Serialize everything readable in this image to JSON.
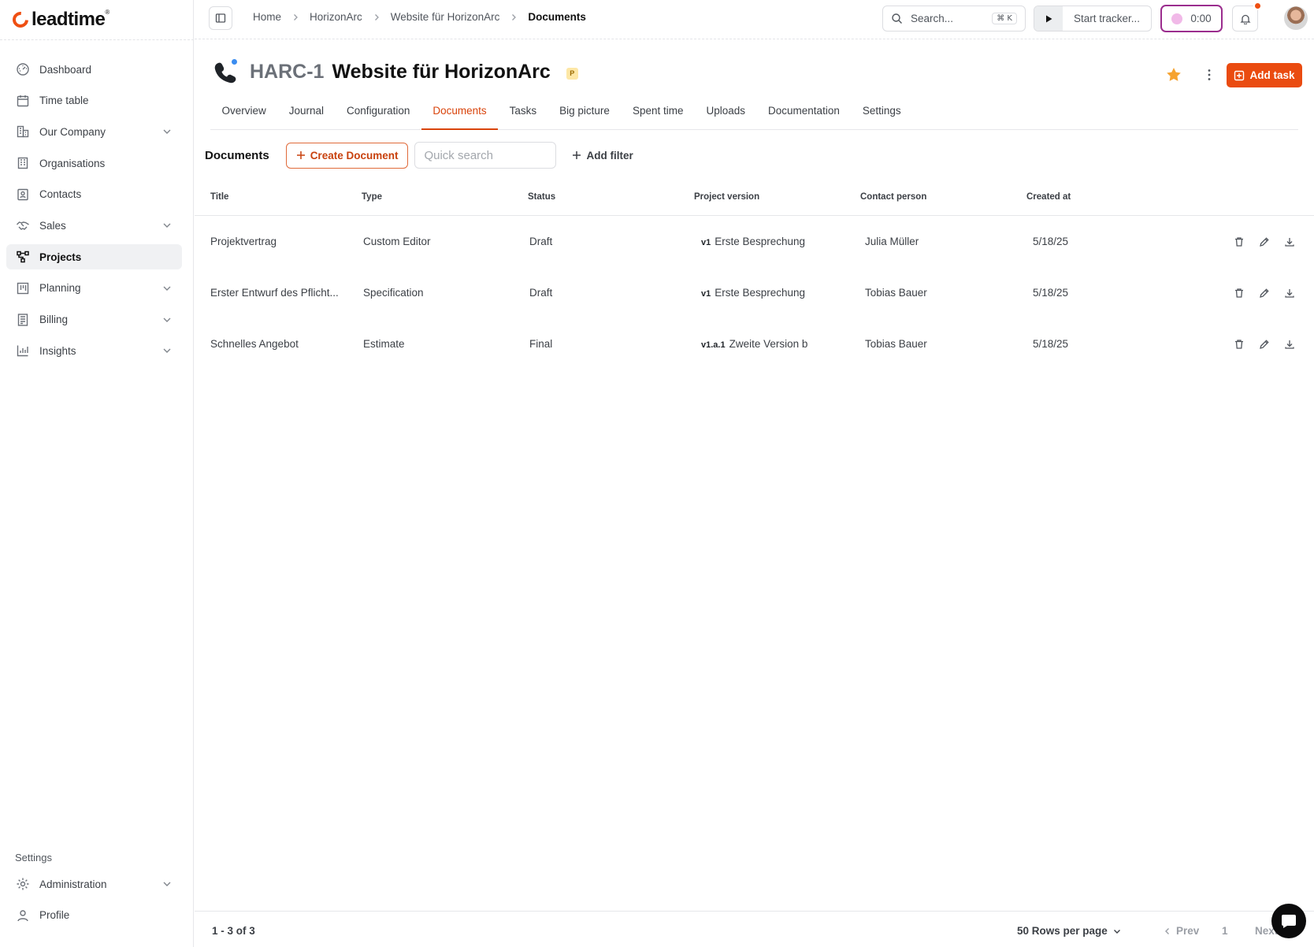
{
  "app": {
    "brand": "leadtime",
    "brand_mark": "®"
  },
  "sidebar": {
    "items": [
      {
        "label": "Dashboard",
        "icon": "dashboard-icon"
      },
      {
        "label": "Time table",
        "icon": "calendar-icon"
      },
      {
        "label": "Our Company",
        "icon": "building-icon",
        "expandable": true
      },
      {
        "label": "Organisations",
        "icon": "organisation-icon"
      },
      {
        "label": "Contacts",
        "icon": "contact-card-icon"
      },
      {
        "label": "Sales",
        "icon": "handshake-icon",
        "expandable": true
      },
      {
        "label": "Projects",
        "icon": "projects-icon",
        "active": true
      },
      {
        "label": "Planning",
        "icon": "kanban-icon",
        "expandable": true
      },
      {
        "label": "Billing",
        "icon": "invoice-icon",
        "expandable": true
      },
      {
        "label": "Insights",
        "icon": "chart-icon",
        "expandable": true
      }
    ],
    "settings_header": "Settings",
    "bottom_items": [
      {
        "label": "Administration",
        "icon": "gear-icon",
        "expandable": true
      },
      {
        "label": "Profile",
        "icon": "user-icon"
      }
    ]
  },
  "topbar": {
    "breadcrumb": [
      "Home",
      "HorizonArc",
      "Website für HorizonArc",
      "Documents"
    ],
    "search_placeholder": "Search...",
    "search_shortcut": "⌘ K",
    "tracker_label": "Start tracker...",
    "timer_value": "0:00"
  },
  "project": {
    "code": "HARC-1",
    "name": "Website für HorizonArc",
    "badge": "P",
    "add_task_label": "Add task"
  },
  "tabs": [
    "Overview",
    "Journal",
    "Configuration",
    "Documents",
    "Tasks",
    "Big picture",
    "Spent time",
    "Uploads",
    "Documentation",
    "Settings"
  ],
  "active_tab": "Documents",
  "toolbar": {
    "title": "Documents",
    "create_label": "Create Document",
    "quick_search_placeholder": "Quick search",
    "add_filter_label": "Add filter"
  },
  "table": {
    "columns": [
      "Title",
      "Type",
      "Status",
      "Project version",
      "Contact person",
      "Created at"
    ],
    "rows": [
      {
        "title": "Projektvertrag",
        "type": "Custom Editor",
        "status": "Draft",
        "version_tag": "v1",
        "version_name": "Erste Besprechung",
        "contact": "Julia Müller",
        "created": "5/18/25"
      },
      {
        "title": "Erster Entwurf des Pflicht...",
        "type": "Specification",
        "status": "Draft",
        "version_tag": "v1",
        "version_name": "Erste Besprechung",
        "contact": "Tobias Bauer",
        "created": "5/18/25"
      },
      {
        "title": "Schnelles Angebot",
        "type": "Estimate",
        "status": "Final",
        "version_tag": "v1.a.1",
        "version_name": "Zweite Version b",
        "contact": "Tobias Bauer",
        "created": "5/18/25"
      }
    ]
  },
  "footer": {
    "range": "1 - 3 of 3",
    "rows_per_page": "50 Rows per page",
    "prev_label": "Prev",
    "page": "1",
    "next_label": "Next"
  },
  "colors": {
    "accent": "#ea4b10",
    "timer_border": "#9b2d8e",
    "star": "#f6a330"
  }
}
